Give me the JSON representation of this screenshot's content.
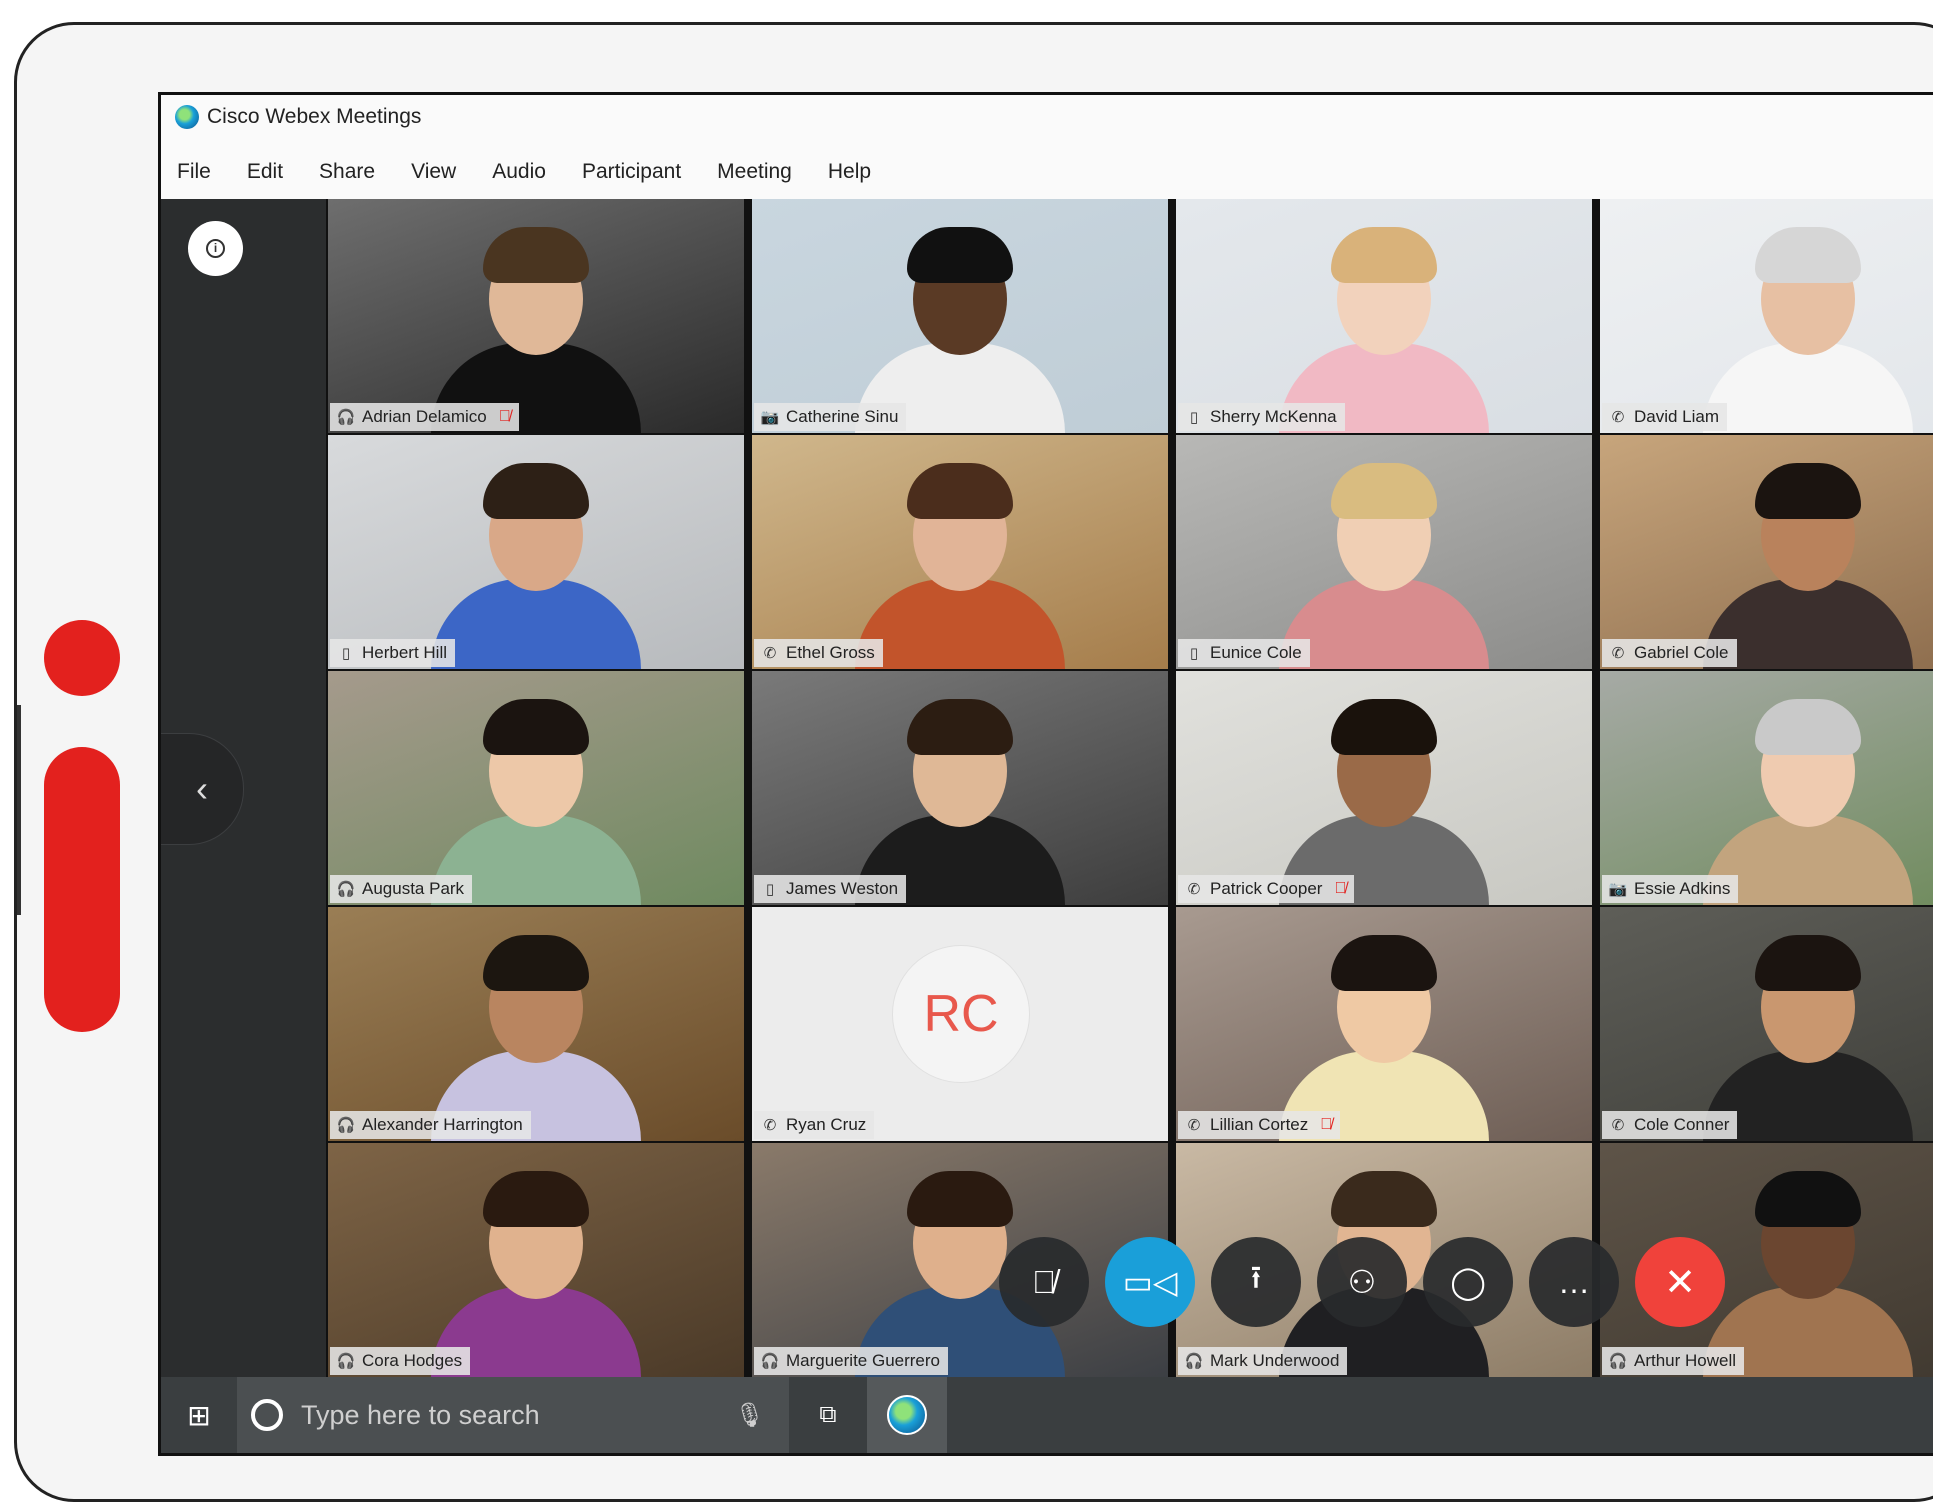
{
  "window": {
    "title": "Cisco Webex Meetings"
  },
  "menu": [
    "File",
    "Edit",
    "Share",
    "View",
    "Audio",
    "Participant",
    "Meeting",
    "Help"
  ],
  "icons": {
    "info": "ⓘ",
    "collapse": "‹",
    "video-device": "📷",
    "phone": "✆",
    "mobile": "▯",
    "headset": "🎧",
    "mute": "🎙̸",
    "mic": "🎙",
    "camera": "🎥",
    "share": "⭱",
    "participants": "👤",
    "chat": "💬",
    "more": "…",
    "end": "✕",
    "windows": "⊞",
    "taskview": "⧉"
  },
  "participants": [
    {
      "name": "Adrian Delamico",
      "device": "headset",
      "muted": true,
      "active": false
    },
    {
      "name": "Catherine Sinu",
      "device": "video-device",
      "muted": false,
      "active": true
    },
    {
      "name": "Sherry McKenna",
      "device": "mobile",
      "muted": false,
      "active": false
    },
    {
      "name": "David Liam",
      "device": "phone",
      "muted": false,
      "active": false
    },
    {
      "name": "Herbert Hill",
      "device": "mobile",
      "muted": false,
      "active": false
    },
    {
      "name": "Ethel Gross",
      "device": "phone",
      "muted": false,
      "active": false
    },
    {
      "name": "Eunice Cole",
      "device": "mobile",
      "muted": false,
      "active": false
    },
    {
      "name": "Gabriel Cole",
      "device": "phone",
      "muted": false,
      "active": false
    },
    {
      "name": "Augusta Park",
      "device": "headset",
      "muted": false,
      "active": false
    },
    {
      "name": "James Weston",
      "device": "mobile",
      "muted": false,
      "active": false
    },
    {
      "name": "Patrick Cooper",
      "device": "phone",
      "muted": true,
      "active": false
    },
    {
      "name": "Essie Adkins",
      "device": "video-device",
      "muted": false,
      "active": false
    },
    {
      "name": "Alexander Harrington",
      "device": "headset",
      "muted": false,
      "active": false
    },
    {
      "name": "Ryan Cruz",
      "device": "phone",
      "muted": false,
      "active": false,
      "initials": "RC"
    },
    {
      "name": "Lillian Cortez",
      "device": "phone",
      "muted": true,
      "active": false
    },
    {
      "name": "Cole Conner",
      "device": "phone",
      "muted": false,
      "active": false
    },
    {
      "name": "Cora Hodges",
      "device": "headset",
      "muted": false,
      "active": false
    },
    {
      "name": "Marguerite Guerrero",
      "device": "headset",
      "muted": false,
      "active": false
    },
    {
      "name": "Mark Underwood",
      "device": "headset",
      "muted": false,
      "active": false
    },
    {
      "name": "Arthur Howell",
      "device": "headset",
      "muted": false,
      "active": false
    }
  ],
  "taskbar": {
    "search_placeholder": "Type here to search"
  },
  "colors": {
    "accent": "#1a9fd9",
    "end_call": "#f0423b",
    "brand_red": "#e3211e",
    "sidebar": "#2b2d2e"
  }
}
